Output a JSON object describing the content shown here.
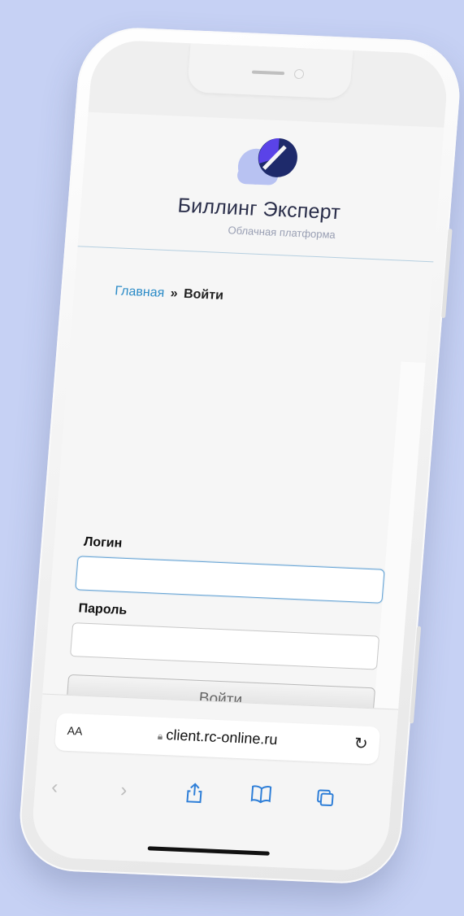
{
  "site": {
    "brand": "Биллинг Эксперт",
    "tagline": "Облачная платформа"
  },
  "breadcrumb": {
    "home": "Главная",
    "separator": "»",
    "current": "Войти"
  },
  "login_form": {
    "login_label": "Логин",
    "login_value": "",
    "password_label": "Пароль",
    "password_value": "",
    "submit_label": "Войти"
  },
  "safari": {
    "text_size_label": "AA",
    "url": "client.rc-online.ru",
    "icons": [
      "back-icon",
      "forward-icon",
      "share-icon",
      "bookmarks-icon",
      "tabs-icon",
      "reload-icon",
      "lock-icon"
    ]
  },
  "colors": {
    "background": "#c6d1f4",
    "link": "#2b8bc7",
    "logo_purple": "#5a43e8",
    "logo_navy": "#1e2a6b",
    "logo_lavender": "#b8c2f2",
    "accent_blue": "#2f7fd8"
  }
}
